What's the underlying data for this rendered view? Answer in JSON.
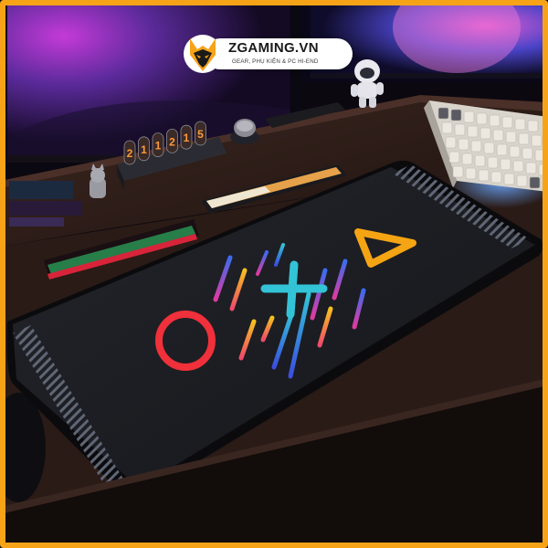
{
  "brand": {
    "name": "ZGAMING.VN",
    "tagline": "GEAR, PHỤ KIỆN & PC HI-END",
    "accent_color": "#f6a318",
    "logo_icon": "fox-head-icon"
  },
  "nixie_clock": {
    "digits": [
      "2",
      "1",
      "1",
      "2",
      "1",
      "5"
    ]
  },
  "desk_mat": {
    "symbols": [
      "circle-symbol",
      "cross-symbol",
      "triangle-symbol"
    ],
    "colors": {
      "mat": "#1c1d22",
      "circle": "#f0303a",
      "cross": "#33c3d6",
      "triangle": "#f5a414"
    }
  }
}
